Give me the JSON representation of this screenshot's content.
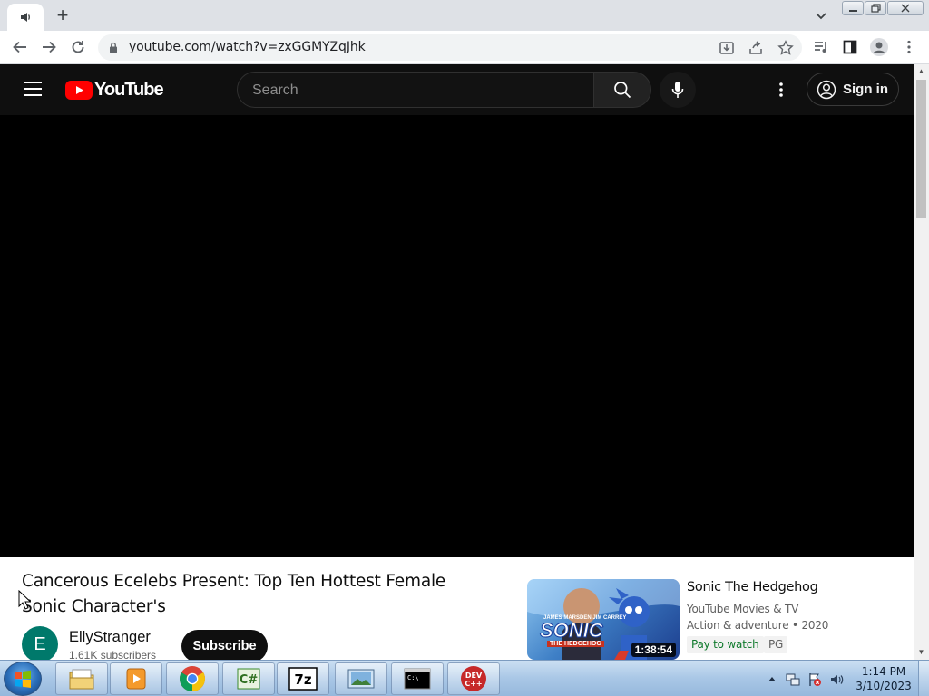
{
  "browser": {
    "url": "youtube.com/watch?v=zxGGMYZqJhk"
  },
  "youtube": {
    "logo_text": "YouTube",
    "search_placeholder": "Search",
    "signin_label": "Sign in"
  },
  "video": {
    "title": "Cancerous Ecelebs Present: Top Ten Hottest Female Sonic Character's",
    "channel": {
      "avatar_letter": "E",
      "name": "EllyStranger",
      "subscribers": "1.61K subscribers"
    },
    "subscribe_label": "Subscribe"
  },
  "recommendation": {
    "title": "Sonic The Hedgehog",
    "channel": "YouTube Movies & TV",
    "meta": "Action & adventure • 2020",
    "badge_pay": "Pay to watch",
    "badge_rating": "PG",
    "duration": "1:38:54",
    "thumb_text": "SONIC",
    "thumb_subtext": "THE HEDGEHOG",
    "thumb_names": "JAMES MARSDEN   JIM CARREY"
  },
  "taskbar": {
    "apps": [
      "windows-explorer",
      "media-player",
      "chrome",
      "csharp-ide",
      "7zip",
      "photo-viewer",
      "command-prompt",
      "dev-cpp"
    ],
    "time": "1:14 PM",
    "date": "3/10/2023"
  },
  "colors": {
    "yt_red": "#ff0000",
    "masthead": "#0f0f0f",
    "player": "#000000",
    "subscribe_bg": "#0f0f0f",
    "pay_badge_text": "#0f7a2c"
  }
}
